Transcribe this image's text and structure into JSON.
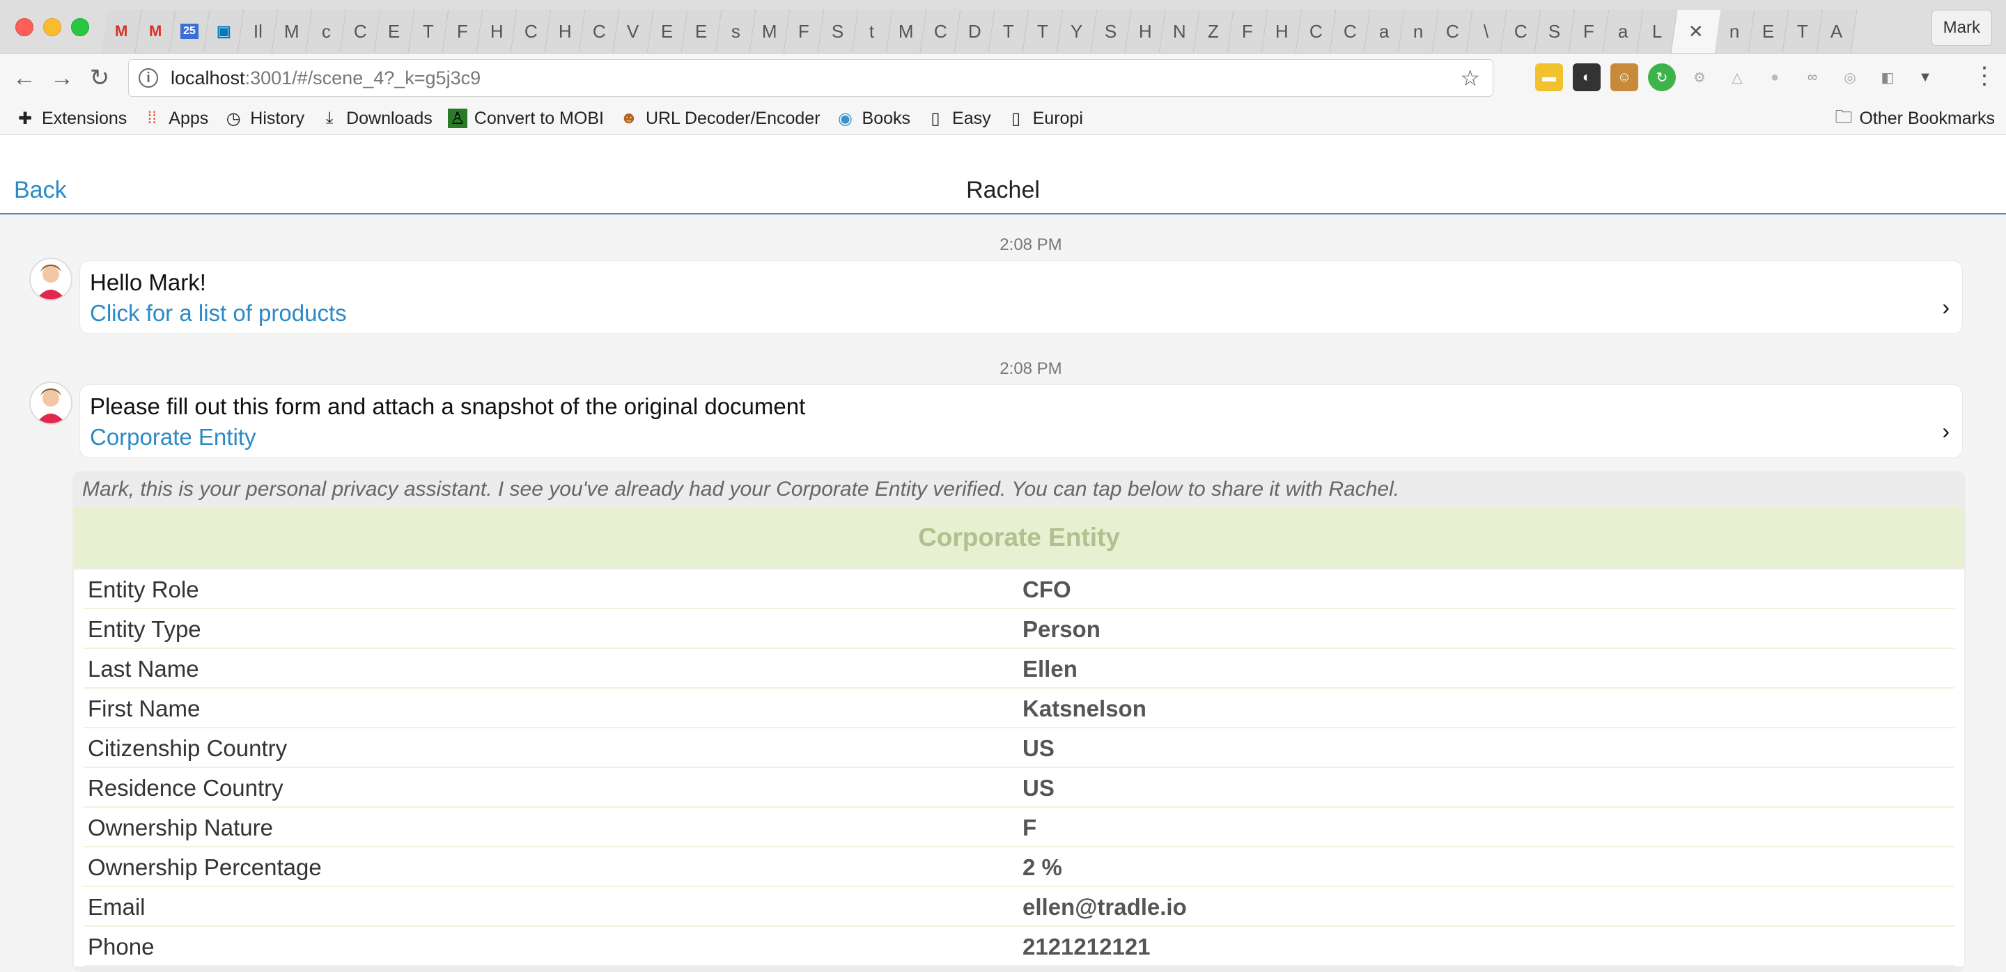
{
  "browser": {
    "tabs": [
      "M",
      "M",
      "25",
      "▣",
      "Il",
      "M",
      "c",
      "C",
      "E",
      "T",
      "F",
      "H",
      "C",
      "H",
      "C",
      "V",
      "E",
      "E",
      "s",
      "M",
      "F",
      "S",
      "t",
      "M",
      "C",
      "D",
      "T",
      "T",
      "Y",
      "S",
      "H",
      "N",
      "Z",
      "F",
      "H",
      "C",
      "C",
      "a",
      "n",
      "C",
      "\\",
      "C",
      "S",
      "F",
      "a",
      "L",
      "n",
      "E",
      "T",
      "A"
    ],
    "active_tab_close": "✕",
    "profile": "Mark",
    "url_host": "localhost",
    "url_rest": ":3001/#/scene_4?_k=g5j3c9",
    "bookmarks": [
      "Extensions",
      "Apps",
      "History",
      "Downloads",
      "Convert to MOBI",
      "URL Decoder/Encoder",
      "Books",
      "Easy",
      "Europi"
    ],
    "other_bookmarks": "Other Bookmarks"
  },
  "chat": {
    "back": "Back",
    "title": "Rachel",
    "messages": [
      {
        "time": "2:08 PM",
        "text": "Hello Mark!",
        "link": "Click for a list of products"
      },
      {
        "time": "2:08 PM",
        "text": "Please fill out this form and attach a snapshot of the original document",
        "link": "Corporate Entity"
      }
    ],
    "card": {
      "intro": "Mark, this is your personal privacy assistant. I see you've already had your Corporate Entity verified. You can tap below to share it with Rachel.",
      "heading": "Corporate Entity",
      "rows": [
        {
          "k": "Entity Role",
          "v": "CFO"
        },
        {
          "k": "Entity Type",
          "v": "Person"
        },
        {
          "k": "Last Name",
          "v": "Ellen"
        },
        {
          "k": "First Name",
          "v": "Katsnelson"
        },
        {
          "k": "Citizenship Country",
          "v": "US"
        },
        {
          "k": "Residence Country",
          "v": "US"
        },
        {
          "k": "Ownership Nature",
          "v": "F"
        },
        {
          "k": "Ownership Percentage",
          "v": "2 %"
        },
        {
          "k": "Email",
          "v": "ellen@tradle.io"
        },
        {
          "k": "Phone",
          "v": "2121212121"
        }
      ]
    }
  },
  "colors": {
    "link": "#2b8ac6",
    "card_header_bg": "#e8f0d2",
    "card_header_text": "#b0c08e"
  }
}
